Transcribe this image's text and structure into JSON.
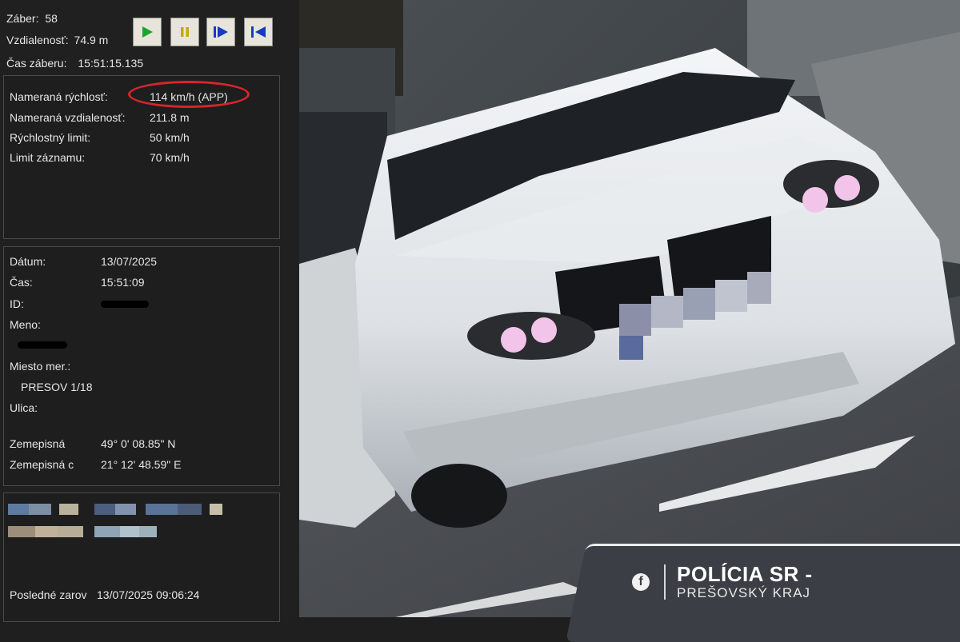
{
  "header": {
    "frame_label": "Záber:",
    "frame_value": "58",
    "distance_label": "Vzdialenosť:",
    "distance_value": "74.9 m",
    "time_label": "Čas záberu:",
    "time_value": "15:51:15.135"
  },
  "playback": {
    "buttons": [
      {
        "name": "play-button",
        "icon": "play-icon",
        "color": "#1aa52e"
      },
      {
        "name": "pause-button",
        "icon": "pause-icon",
        "color": "#c9a800"
      },
      {
        "name": "next-frame-button",
        "icon": "step-forward-icon",
        "color": "#1838c8"
      },
      {
        "name": "first-frame-button",
        "icon": "skip-back-icon",
        "color": "#1838c8"
      }
    ]
  },
  "measurement": {
    "speed_label": "Nameraná rýchlosť:",
    "speed_value": "114 km/h (APP)",
    "distance_label": "Nameraná vzdialenosť:",
    "distance_value": "211.8 m",
    "limit_label": "Rýchlostný limit:",
    "limit_value": "50 km/h",
    "record_limit_label": "Limit záznamu:",
    "record_limit_value": "70 km/h",
    "highlight_color": "#d8252b"
  },
  "details": {
    "date_label": "Dátum:",
    "date_value": "13/07/2025",
    "time_label": "Čas:",
    "time_value": "15:51:09",
    "id_label": "ID:",
    "name_label": "Meno:",
    "place_label": "Miesto mer.:",
    "place_value": "PRESOV 1/18",
    "street_label": "Ulica:",
    "lat_label": "Zemepisná",
    "lat_value": "49° 0' 08.85\" N",
    "lon_label": "Zemepisná c",
    "lon_value": "21° 12' 48.59\" E"
  },
  "footer": {
    "last_label": "Posledné zarov",
    "last_value": "13/07/2025  09:06:24"
  },
  "watermark": {
    "icon": "facebook-icon",
    "line1": "POLÍCIA SR -",
    "line2": "PREŠOVSKÝ KRAJ"
  }
}
